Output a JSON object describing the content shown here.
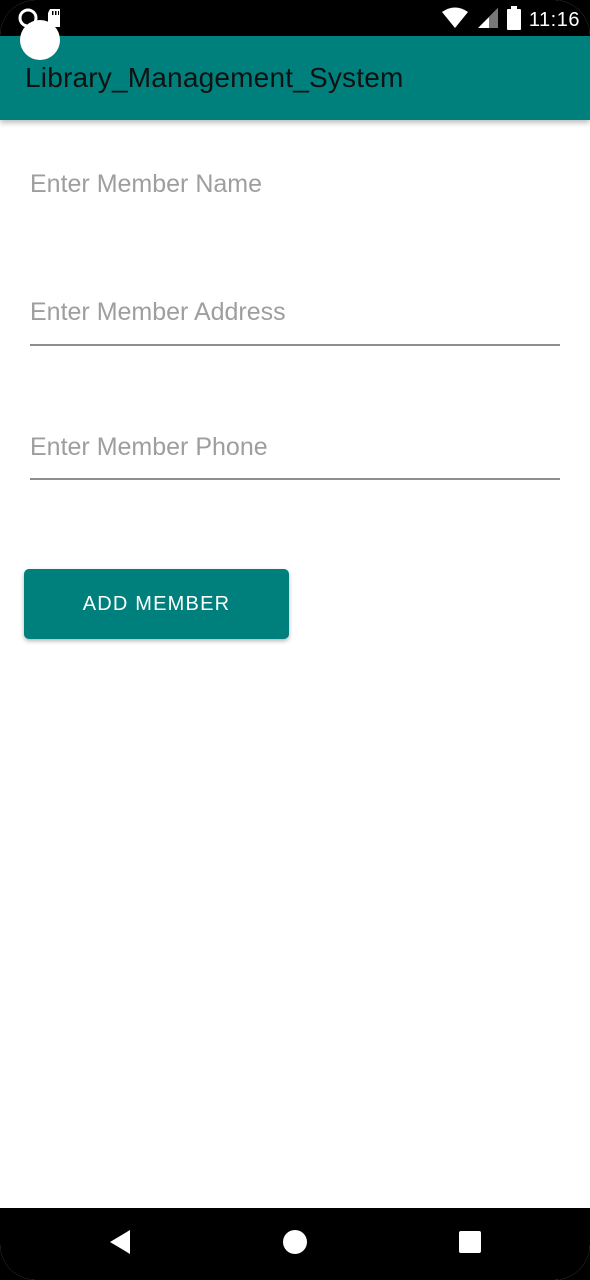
{
  "status_bar": {
    "time": "11:16",
    "icons": [
      "signal-dot-icon",
      "sd-card-icon",
      "wifi-icon",
      "cell-signal-icon",
      "battery-icon"
    ]
  },
  "app_bar": {
    "title": "Library_Management_System",
    "color": "#00807c"
  },
  "form": {
    "member_name": {
      "value": "",
      "placeholder": "Enter Member Name"
    },
    "member_address": {
      "value": "",
      "placeholder": "Enter Member Address"
    },
    "member_phone": {
      "value": "",
      "placeholder": "Enter Member Phone"
    },
    "add_button_label": "ADD MEMBER"
  },
  "nav_bar": {
    "buttons": [
      "back-icon",
      "home-icon",
      "recents-icon"
    ]
  }
}
